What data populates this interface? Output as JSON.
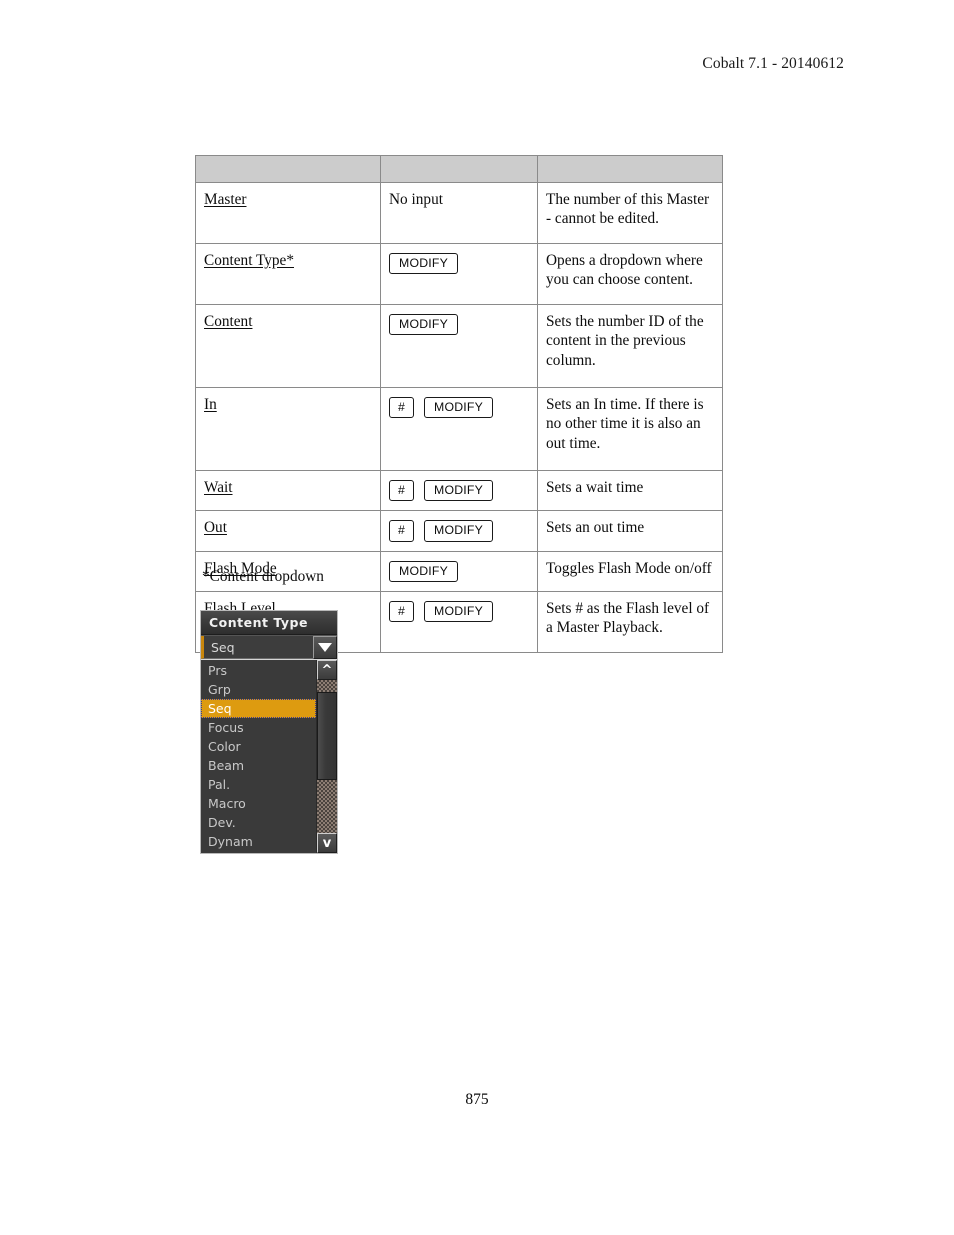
{
  "header": {
    "doc_version": "Cobalt 7.1 - 20140612"
  },
  "table": {
    "columns": [
      "",
      "",
      ""
    ],
    "rows": [
      {
        "term": "Master",
        "input": {
          "type": "text",
          "text": "No input"
        },
        "description": "The number of this Master - cannot be edited."
      },
      {
        "term": "Content Type*",
        "input": {
          "type": "buttons",
          "hash": "",
          "modify": "MODIFY"
        },
        "description": "Opens a dropdown where you can choose content."
      },
      {
        "term": "Content",
        "input": {
          "type": "buttons",
          "hash": "",
          "modify": "MODIFY"
        },
        "description": "Sets the number ID of the content in the previous column."
      },
      {
        "term": "In",
        "input": {
          "type": "buttons",
          "hash": "#",
          "modify": "MODIFY"
        },
        "description": "Sets an In time. If there is no other time it is also an out time."
      },
      {
        "term": "Wait",
        "input": {
          "type": "buttons",
          "hash": "#",
          "modify": "MODIFY"
        },
        "description": "Sets a wait time"
      },
      {
        "term": "Out",
        "input": {
          "type": "buttons",
          "hash": "#",
          "modify": "MODIFY"
        },
        "description": "Sets an out time"
      },
      {
        "term": "Flash Mode",
        "input": {
          "type": "buttons",
          "hash": "",
          "modify": "MODIFY"
        },
        "description": "Toggles Flash Mode on/off"
      },
      {
        "term": "Flash Level",
        "input": {
          "type": "buttons",
          "hash": "#",
          "modify": "MODIFY"
        },
        "description": "Sets # as the Flash level of a Master Playback."
      }
    ]
  },
  "caption": "*Content dropdown",
  "dropdown": {
    "title": "Content Type",
    "selected_value": "Seq",
    "arrow_icon": "triangle-down-icon",
    "scroll_up_icon": "^",
    "scroll_down_icon": "v",
    "items": [
      "Prs",
      "Grp",
      "Seq",
      "Focus",
      "Color",
      "Beam",
      "Pal.",
      "Macro",
      "Dev.",
      "Dynam"
    ],
    "selected_index": 2,
    "colors": {
      "highlight": "#dd9b10",
      "accent": "#c8860d",
      "panel_bg": "#3a3a3a",
      "title_text": "#f2f2f2",
      "item_text": "#c9c9c9"
    }
  },
  "footer": {
    "page_number": "875"
  }
}
